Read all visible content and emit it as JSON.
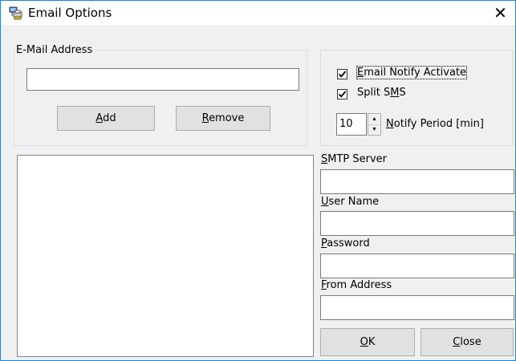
{
  "window": {
    "title": "Email Options",
    "close_glyph": "✕",
    "app_icon": "printer-network-icon"
  },
  "email_group": {
    "label": "E-Mail Address",
    "input_value": "",
    "add_button": {
      "prefix": "",
      "mnemonic": "A",
      "suffix": "dd"
    },
    "remove_button": {
      "prefix": "",
      "mnemonic": "R",
      "suffix": "emove"
    }
  },
  "options_group": {
    "notify_activate": {
      "checked": true,
      "prefix": "",
      "mnemonic": "E",
      "suffix": "mail Notify Activate"
    },
    "split_sms": {
      "checked": true,
      "prefix": "Split S",
      "mnemonic": "M",
      "suffix": "S"
    },
    "notify_period": {
      "value": "10",
      "prefix": "",
      "mnemonic": "N",
      "suffix": "otify Period [min]"
    }
  },
  "email_list": {
    "items": []
  },
  "smtp": {
    "server": {
      "prefix": "",
      "mnemonic": "S",
      "suffix": "MTP Server",
      "value": ""
    },
    "user": {
      "prefix": "",
      "mnemonic": "U",
      "suffix": "ser Name",
      "value": ""
    },
    "password": {
      "prefix": "",
      "mnemonic": "P",
      "suffix": "assword",
      "value": ""
    },
    "from": {
      "prefix": "",
      "mnemonic": "F",
      "suffix": "rom Address",
      "value": ""
    }
  },
  "footer": {
    "ok_button": {
      "prefix": "",
      "mnemonic": "O",
      "suffix": "K"
    },
    "close_button": {
      "prefix": "",
      "mnemonic": "C",
      "suffix": "lose"
    }
  },
  "colors": {
    "window_border": "#1883d7",
    "face": "#f0f0f0"
  }
}
